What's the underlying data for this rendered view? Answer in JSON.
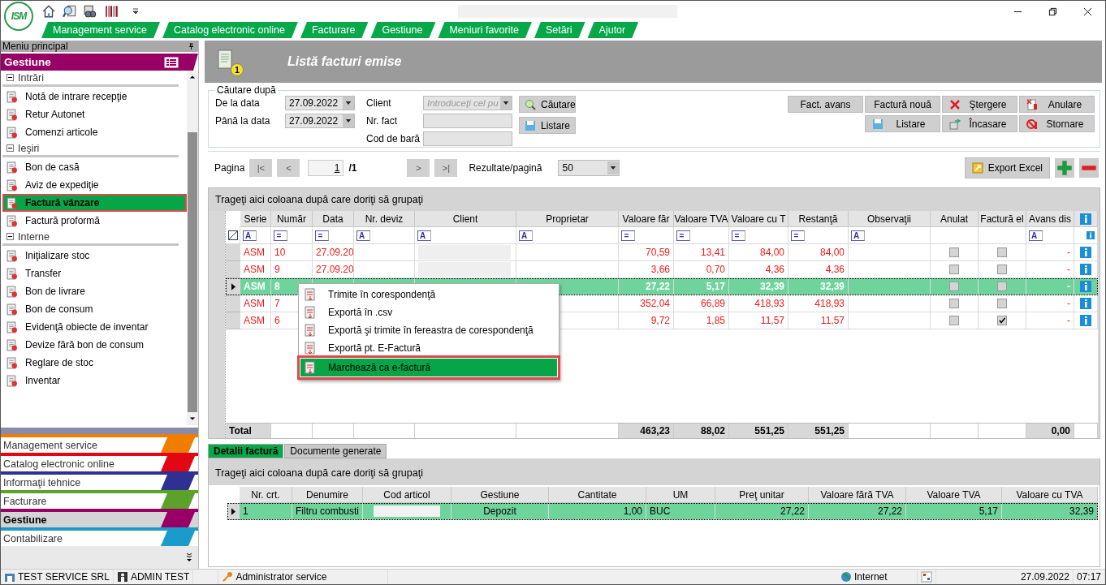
{
  "logo_text": "ISM",
  "menu_tabs": [
    {
      "label": "Management service"
    },
    {
      "label": "Catalog electronic online"
    },
    {
      "label": "Facturare"
    },
    {
      "label": "Gestiune"
    },
    {
      "label": "Meniuri favorite"
    },
    {
      "label": "Setări"
    },
    {
      "label": "Ajutor"
    }
  ],
  "sidebar": {
    "title": "Meniu principal",
    "module_title": "Gestiune",
    "groups": [
      {
        "label": "Intrări",
        "expanded": true,
        "items": [
          {
            "label": "Notă de intrare recepţie",
            "selected": false
          },
          {
            "label": "Retur Autonet",
            "selected": false
          },
          {
            "label": "Comenzi articole",
            "selected": false
          }
        ]
      },
      {
        "label": "Ieşiri",
        "expanded": true,
        "items": [
          {
            "label": "Bon de casă",
            "selected": false
          },
          {
            "label": "Aviz de expediţie",
            "selected": false
          },
          {
            "label": "Factură vânzare",
            "selected": true
          },
          {
            "label": "Factură proformă",
            "selected": false
          }
        ]
      },
      {
        "label": "Interne",
        "expanded": true,
        "items": [
          {
            "label": "Iniţializare stoc",
            "selected": false
          },
          {
            "label": "Transfer",
            "selected": false
          },
          {
            "label": "Bon de livrare",
            "selected": false
          },
          {
            "label": "Bon de consum",
            "selected": false
          },
          {
            "label": "Evidenţă obiecte de inventar",
            "selected": false
          },
          {
            "label": "Devize fără bon de consum",
            "selected": false
          },
          {
            "label": "Reglare de stoc",
            "selected": false
          },
          {
            "label": "Inventar",
            "selected": false
          }
        ]
      }
    ],
    "modules": [
      {
        "label": "Management service",
        "color": "#f07d00",
        "selected": false
      },
      {
        "label": "Catalog electronic online",
        "color": "#e30613",
        "selected": false
      },
      {
        "label": "Informaţii tehnice",
        "color": "#2e3192",
        "selected": false
      },
      {
        "label": "Facturare",
        "color": "#5ba12a",
        "selected": false
      },
      {
        "label": "Gestiune",
        "color": "#990066",
        "selected": true
      },
      {
        "label": "Contabilizare",
        "color": "#1a9bc9",
        "selected": false
      }
    ]
  },
  "page": {
    "title": "Listă facturi emise",
    "badge": "1"
  },
  "search": {
    "legend": "Căutare după",
    "from": {
      "label": "De la data",
      "value": "27.09.2022"
    },
    "to": {
      "label": "Până la data",
      "value": "27.09.2022"
    },
    "client": {
      "label": "Client",
      "placeholder": "Introduceţi cel pu"
    },
    "invoice_no": {
      "label": "Nr. fact"
    },
    "barcode": {
      "label": "Cod de bară"
    },
    "buttons": [
      {
        "label": "Căutare",
        "kind": "search"
      },
      {
        "label": "Listare",
        "kind": "list"
      }
    ]
  },
  "actions": [
    {
      "label": "Fact. avans",
      "kind": "plain"
    },
    {
      "label": "Factură nouă",
      "kind": "plain"
    },
    {
      "label": "Ştergere",
      "kind": "delete"
    },
    {
      "label": "Anulare",
      "kind": "cancel"
    },
    {
      "label": "Listare",
      "kind": "list"
    },
    {
      "label": "Încasare",
      "kind": "cash"
    },
    {
      "label": "Stornare",
      "kind": "storno"
    }
  ],
  "pager": {
    "label": "Pagina",
    "first": "|<",
    "prev": "<",
    "page": "1",
    "total": "/1",
    "next": ">",
    "last": ">|",
    "per_page_label": "Rezultate/pagină",
    "per_page": "50",
    "export": "Export Excel"
  },
  "grid": {
    "group_hint": "Trageţi aici coloana după care doriţi să grupaţi",
    "columns": [
      {
        "label": "Serie",
        "filter": "A"
      },
      {
        "label": "Număr",
        "filter": "="
      },
      {
        "label": "Data",
        "filter": "="
      },
      {
        "label": "Nr. deviz",
        "filter": "A"
      },
      {
        "label": "Client",
        "filter": "A"
      },
      {
        "label": "Proprietar",
        "filter": "A"
      },
      {
        "label": "Valoare făr",
        "filter": "="
      },
      {
        "label": "Valoare TVA",
        "filter": "="
      },
      {
        "label": "Valoare cu T",
        "filter": "="
      },
      {
        "label": "Restanţă",
        "filter": "="
      },
      {
        "label": "Observaţii",
        "filter": "A"
      },
      {
        "label": "Anulat"
      },
      {
        "label": "Factură el"
      },
      {
        "label": "Avans dis",
        "filter": "A"
      }
    ],
    "rows": [
      {
        "serie": "ASM",
        "numar": "10",
        "data": "27.09.20",
        "client_redacted": true,
        "val_fara": "70,59",
        "val_tva": "13,41",
        "val_cu": "84,00",
        "restanta": "84,00",
        "anulat": false,
        "factura_el": false,
        "avans": "-",
        "selected": false
      },
      {
        "serie": "ASM",
        "numar": "9",
        "data": "27.09.20",
        "client_redacted": true,
        "val_fara": "3,66",
        "val_tva": "0,70",
        "val_cu": "4,36",
        "restanta": "4,36",
        "anulat": false,
        "factura_el": false,
        "avans": "-",
        "selected": false
      },
      {
        "serie": "ASM",
        "numar": "8",
        "val_fara": "27,22",
        "val_tva": "5,17",
        "val_cu": "32,39",
        "restanta": "32,39",
        "anulat": false,
        "factura_el": false,
        "avans": "-",
        "selected": true
      },
      {
        "serie": "ASM",
        "numar": "7",
        "val_fara": "352,04",
        "val_tva": "66,89",
        "val_cu": "418,93",
        "restanta": "418,93",
        "anulat": false,
        "factura_el": false,
        "avans": "-",
        "selected": false
      },
      {
        "serie": "ASM",
        "numar": "6",
        "val_fara": "9,72",
        "val_tva": "1,85",
        "val_cu": "11,57",
        "restanta": "11,57",
        "anulat": false,
        "factura_el": true,
        "avans": "-",
        "selected": false
      }
    ],
    "totals": {
      "label": "Total",
      "val_fara": "463,23",
      "val_tva": "88,02",
      "val_cu": "551,25",
      "restanta": "551,25",
      "avans": "0,00"
    }
  },
  "context_menu": [
    {
      "label": "Trimite în corespondenţă",
      "selected": false
    },
    {
      "label": "Exportă în .csv",
      "selected": false
    },
    {
      "label": "Exportă şi trimite în fereastra de corespondenţă",
      "selected": false
    },
    {
      "label": "Exportă pt. E-Factură",
      "selected": false
    },
    {
      "label": "Marchează ca e-factură",
      "selected": true
    }
  ],
  "detail": {
    "tabs": [
      {
        "label": "Detalii factură",
        "selected": true
      },
      {
        "label": "Documente generate",
        "selected": false
      }
    ],
    "group_hint": "Trageţi aici coloana după care doriţi să grupaţi",
    "columns": [
      {
        "label": "Nr. crt."
      },
      {
        "label": "Denumire"
      },
      {
        "label": "Cod articol"
      },
      {
        "label": "Gestiune"
      },
      {
        "label": "Cantitate"
      },
      {
        "label": "UM"
      },
      {
        "label": "Preţ unitar"
      },
      {
        "label": "Valoare fără TVA"
      },
      {
        "label": "Valoare TVA"
      },
      {
        "label": "Valoare cu TVA"
      }
    ],
    "rows": [
      {
        "nr": "1",
        "denumire": "Filtru combusti",
        "cod_redacted": true,
        "gestiune": "Depozit",
        "cantitate": "1,00",
        "um": "BUC",
        "pret": "27,22",
        "val_fara": "27,22",
        "val_tva": "5,17",
        "val_cu": "32,39",
        "selected": true
      }
    ]
  },
  "status_bar": {
    "company": "TEST SERVICE SRL",
    "user": "ADMIN TEST",
    "role": "Administrator service",
    "zone": "Internet",
    "date": "27.09.2022",
    "time": "07:17"
  }
}
